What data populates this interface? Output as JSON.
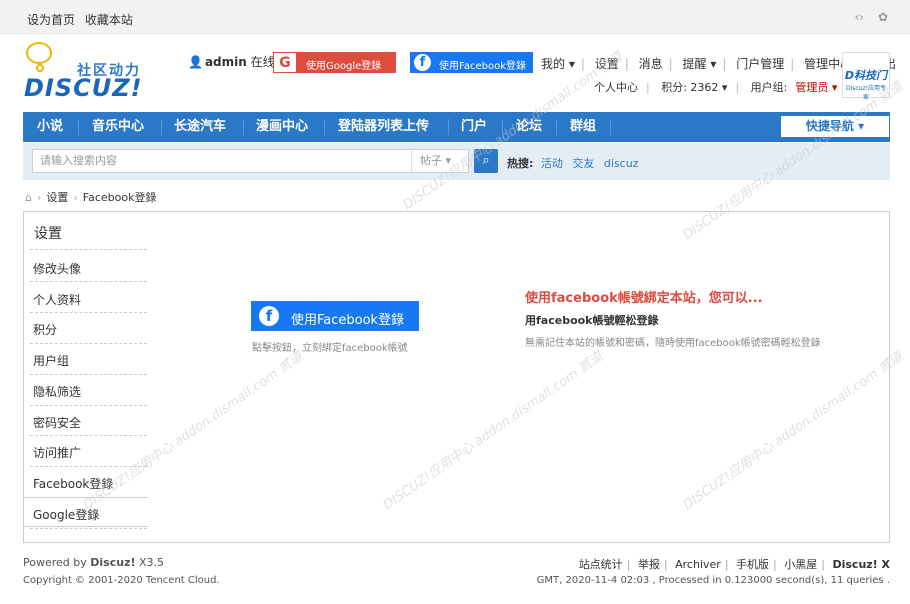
{
  "topbar": {
    "set_home": "设为首页",
    "bookmark": "收藏本站"
  },
  "logo": {
    "cn": "社区动力",
    "en": "DISCUZ!"
  },
  "user": {
    "name": "admin",
    "status": "在线"
  },
  "login": {
    "google": "使用Google登錄",
    "facebook": "使用Facebook登錄"
  },
  "toplinks": [
    "我的 ▾",
    "设置",
    "消息",
    "提醒 ▾",
    "门户管理",
    "管理中心",
    "退出"
  ],
  "subline": {
    "center": "个人中心",
    "points": "积分: 2362 ▾",
    "group_label": "用户组:",
    "group": "管理员 ▾"
  },
  "badge": {
    "title": "D科技门",
    "sub": "Discuz!应用专家"
  },
  "nav": [
    "小说",
    "音乐中心",
    "长途汽车",
    "漫画中心",
    "登陆器列表上传",
    "门户",
    "论坛",
    "群组"
  ],
  "quick_nav": "快捷导航 ▾",
  "search": {
    "placeholder": "请输入搜索内容",
    "type": "帖子 ▾"
  },
  "hot": {
    "label": "热搜:",
    "items": [
      "活动",
      "交友",
      "discuz"
    ]
  },
  "breadcrumb": {
    "a": "设置",
    "b": "Facebook登錄"
  },
  "sidebar": {
    "title": "设置",
    "items": [
      "修改头像",
      "个人资料",
      "积分",
      "用户组",
      "隐私筛选",
      "密码安全",
      "访问推广",
      "Facebook登錄",
      "Google登錄"
    ]
  },
  "main": {
    "fb_button": "使用Facebook登錄",
    "fb_hint": "點擊按鈕，立刻綁定facebook帳號",
    "title": "使用facebook帳號綁定本站，您可以...",
    "sub": "用facebook帳號輕松登錄",
    "desc": "無需記住本站的帳號和密碼，隨時使用facebook帳號密碼輕松登錄"
  },
  "footer": {
    "powered_prefix": "Powered by ",
    "powered_brand": "Discuz!",
    "powered_ver": " X3.5",
    "copyright": "Copyright © 2001-2020 Tencent Cloud.",
    "links": [
      "站点统计",
      "举报",
      "Archiver",
      "手机版",
      "小黑屋",
      "Discuz! X"
    ],
    "stats": "GMT, 2020-11-4 02:03 , Processed in 0.123000 second(s), 11 queries ."
  },
  "watermark": "DISCUZ!应用中心 addon.dismall.com 贰道"
}
